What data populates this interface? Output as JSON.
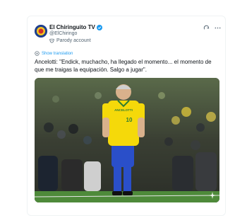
{
  "tweet": {
    "display_name": "El Chiringuito TV",
    "handle": "@ElChiringo",
    "parody_label": "Parody account",
    "translate_label": "Show translation",
    "text": "Ancelotti: \"Endick, muchacho, ha llegado el momento... el momento de que me traigas la equipación. Salgo a jugar\".",
    "media": {
      "shirt_name": "ANCELOTTI",
      "shirt_number": "10"
    }
  },
  "colors": {
    "accent": "#1d9bf0",
    "shirt_yellow": "#f5d90a",
    "shorts_blue": "#2a4fc9",
    "pitch_green": "#4e8a3a"
  },
  "icons": {
    "verified": "verified-badge-icon",
    "parody": "parody-mask-icon",
    "translate": "translate-icon",
    "grok": "grok-icon",
    "more": "more-icon",
    "sparkle": "sparkle-icon"
  }
}
